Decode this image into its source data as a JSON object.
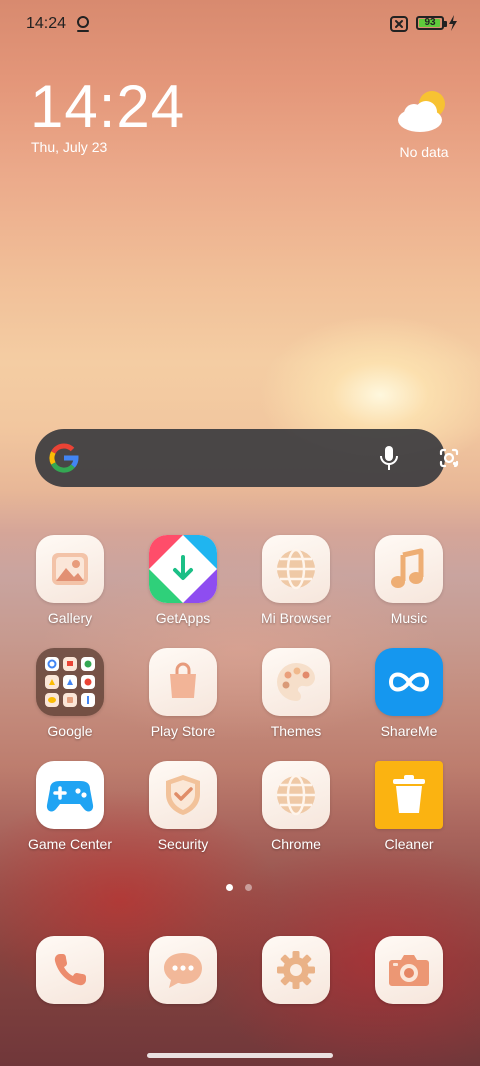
{
  "status_bar": {
    "time": "14:24",
    "battery_level": "93",
    "battery_color": "#5ecb3b"
  },
  "clock_widget": {
    "time": "14:24",
    "date": "Thu, July 23"
  },
  "weather_widget": {
    "text": "No data",
    "icon": "partly-cloudy-icon"
  },
  "search_bar": {
    "icons": [
      "google-logo-icon",
      "microphone-icon",
      "google-lens-icon"
    ]
  },
  "apps": [
    {
      "label": "Gallery",
      "icon": "gallery-icon"
    },
    {
      "label": "GetApps",
      "icon": "getapps-icon"
    },
    {
      "label": "Mi Browser",
      "icon": "globe-icon"
    },
    {
      "label": "Music",
      "icon": "music-note-icon"
    },
    {
      "label": "Google",
      "icon": "google-folder-icon"
    },
    {
      "label": "Play Store",
      "icon": "shopping-bag-icon"
    },
    {
      "label": "Themes",
      "icon": "palette-icon"
    },
    {
      "label": "ShareMe",
      "icon": "infinity-icon"
    },
    {
      "label": "Game Center",
      "icon": "gamepad-icon"
    },
    {
      "label": "Security",
      "icon": "shield-check-icon"
    },
    {
      "label": "Chrome",
      "icon": "globe-icon"
    },
    {
      "label": "Cleaner",
      "icon": "trash-icon"
    }
  ],
  "page_indicator": {
    "pages": 2,
    "active": 1
  },
  "dock": [
    {
      "name": "phone",
      "icon": "phone-icon"
    },
    {
      "name": "messages",
      "icon": "chat-bubble-icon"
    },
    {
      "name": "settings",
      "icon": "gear-icon"
    },
    {
      "name": "camera",
      "icon": "camera-icon"
    }
  ]
}
